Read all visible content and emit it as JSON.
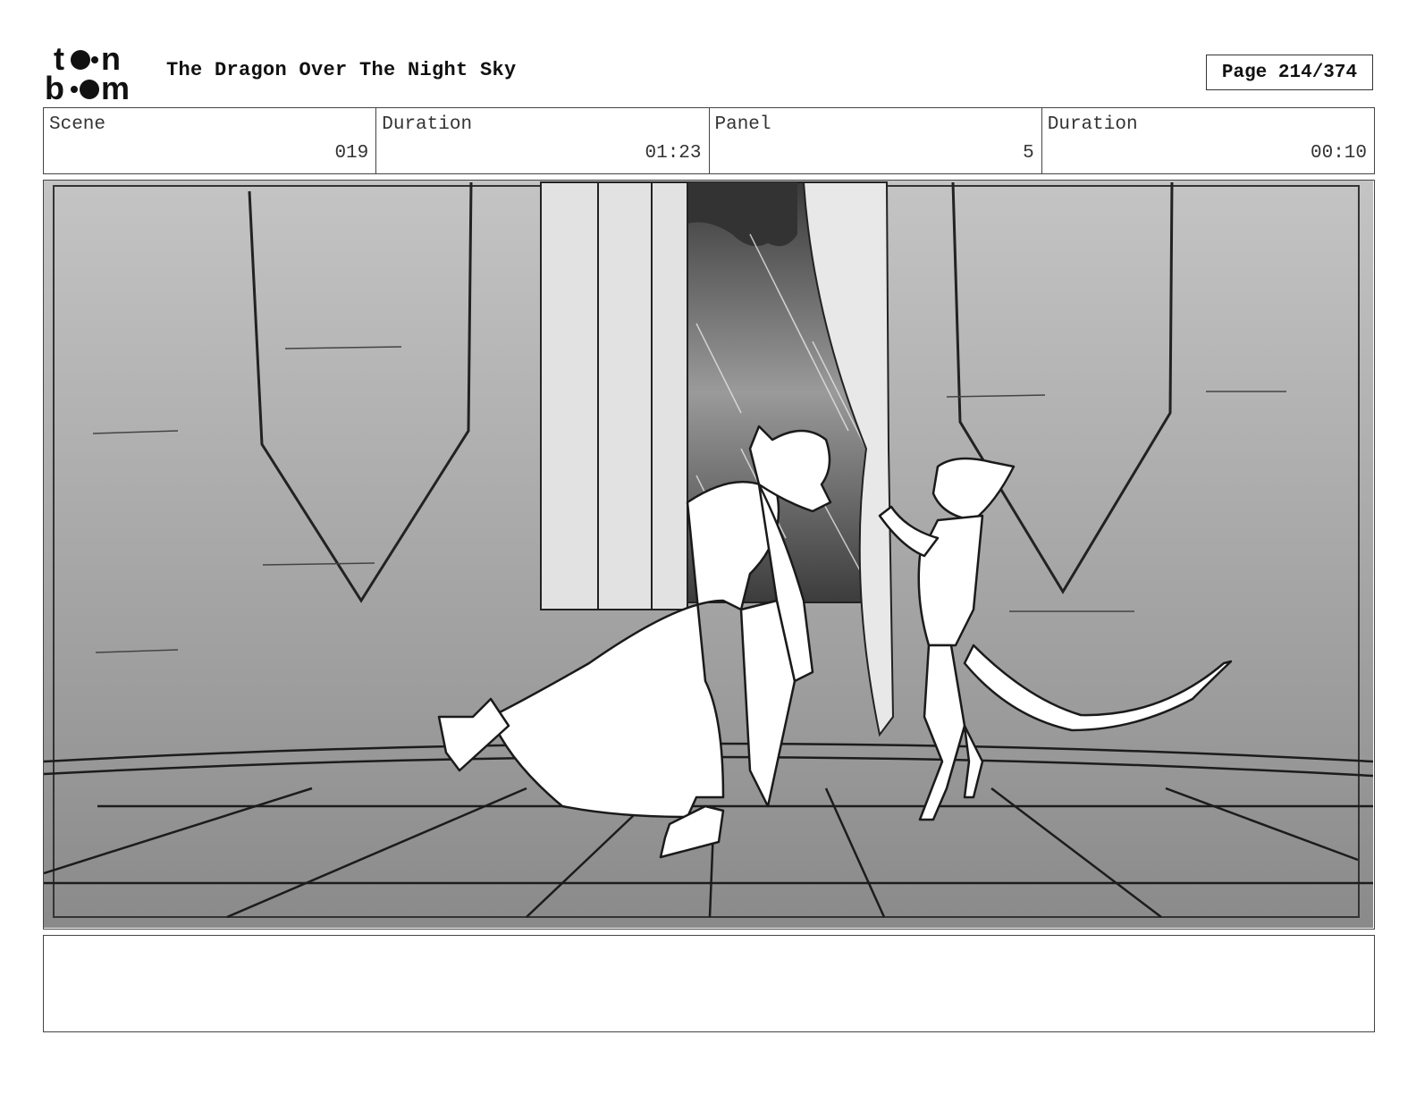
{
  "header": {
    "logo_text_top": "toon",
    "logo_text_bottom": "boom",
    "title": "The Dragon Over The Night Sky",
    "page": "Page 214/374"
  },
  "info": [
    {
      "label": "Scene",
      "value": "019"
    },
    {
      "label": "Duration",
      "value": "01:23"
    },
    {
      "label": "Panel",
      "value": "5"
    },
    {
      "label": "Duration",
      "value": "00:10"
    }
  ],
  "notes": {
    "text": ""
  }
}
